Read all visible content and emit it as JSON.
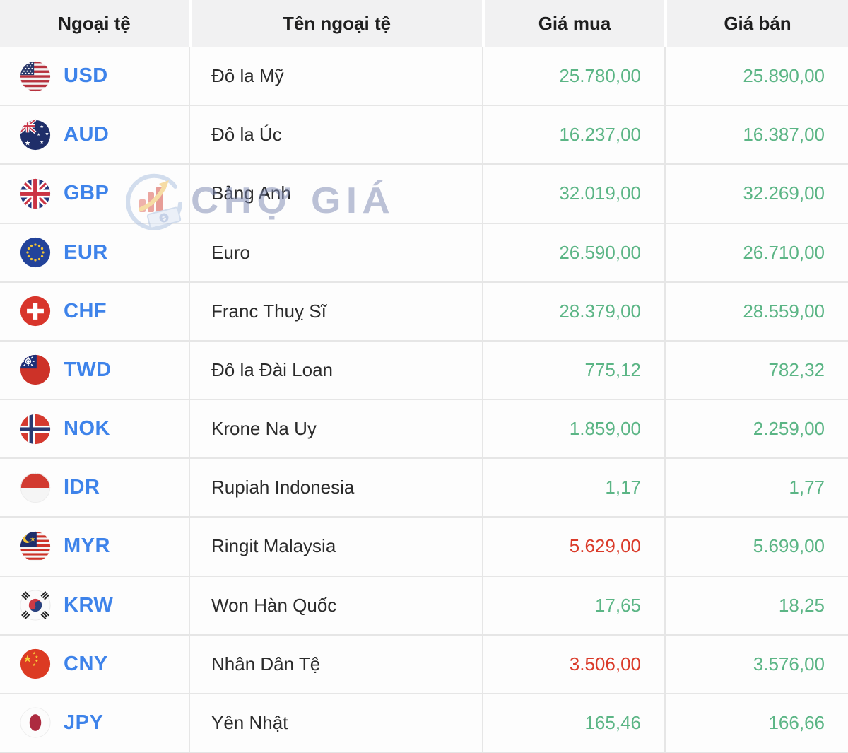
{
  "header": {
    "col_currency": "Ngoại tệ",
    "col_name": "Tên ngoại tệ",
    "col_buy": "Giá mua",
    "col_sell": "Giá bán"
  },
  "watermark": {
    "text": "CHỢ GIÁ",
    "logo_icon": "chogia-logo-icon"
  },
  "colors": {
    "up": "#5bb585",
    "down": "#da3a29",
    "code": "#3e83ea",
    "header_bg": "#f1f1f2",
    "row_separator": "#e6e6e6"
  },
  "rows": [
    {
      "code": "USD",
      "flag": "usd",
      "name": "Đô la Mỹ",
      "buy": "25.780,00",
      "sell": "25.890,00",
      "buy_trend": "up",
      "sell_trend": "up"
    },
    {
      "code": "AUD",
      "flag": "aud",
      "name": "Đô la Úc",
      "buy": "16.237,00",
      "sell": "16.387,00",
      "buy_trend": "up",
      "sell_trend": "up"
    },
    {
      "code": "GBP",
      "flag": "gbp",
      "name": "Bảng Anh",
      "buy": "32.019,00",
      "sell": "32.269,00",
      "buy_trend": "up",
      "sell_trend": "up"
    },
    {
      "code": "EUR",
      "flag": "eur",
      "name": "Euro",
      "buy": "26.590,00",
      "sell": "26.710,00",
      "buy_trend": "up",
      "sell_trend": "up"
    },
    {
      "code": "CHF",
      "flag": "chf",
      "name": "Franc Thuỵ Sĩ",
      "buy": "28.379,00",
      "sell": "28.559,00",
      "buy_trend": "up",
      "sell_trend": "up"
    },
    {
      "code": "TWD",
      "flag": "twd",
      "name": "Đô la Đài Loan",
      "buy": "775,12",
      "sell": "782,32",
      "buy_trend": "up",
      "sell_trend": "up"
    },
    {
      "code": "NOK",
      "flag": "nok",
      "name": "Krone Na Uy",
      "buy": "1.859,00",
      "sell": "2.259,00",
      "buy_trend": "up",
      "sell_trend": "up"
    },
    {
      "code": "IDR",
      "flag": "idr",
      "name": "Rupiah Indonesia",
      "buy": "1,17",
      "sell": "1,77",
      "buy_trend": "up",
      "sell_trend": "up"
    },
    {
      "code": "MYR",
      "flag": "myr",
      "name": "Ringit Malaysia",
      "buy": "5.629,00",
      "sell": "5.699,00",
      "buy_trend": "down",
      "sell_trend": "up"
    },
    {
      "code": "KRW",
      "flag": "krw",
      "name": "Won Hàn Quốc",
      "buy": "17,65",
      "sell": "18,25",
      "buy_trend": "up",
      "sell_trend": "up"
    },
    {
      "code": "CNY",
      "flag": "cny",
      "name": "Nhân Dân Tệ",
      "buy": "3.506,00",
      "sell": "3.576,00",
      "buy_trend": "down",
      "sell_trend": "up"
    },
    {
      "code": "JPY",
      "flag": "jpy",
      "name": "Yên Nhật",
      "buy": "165,46",
      "sell": "166,66",
      "buy_trend": "up",
      "sell_trend": "up"
    }
  ]
}
